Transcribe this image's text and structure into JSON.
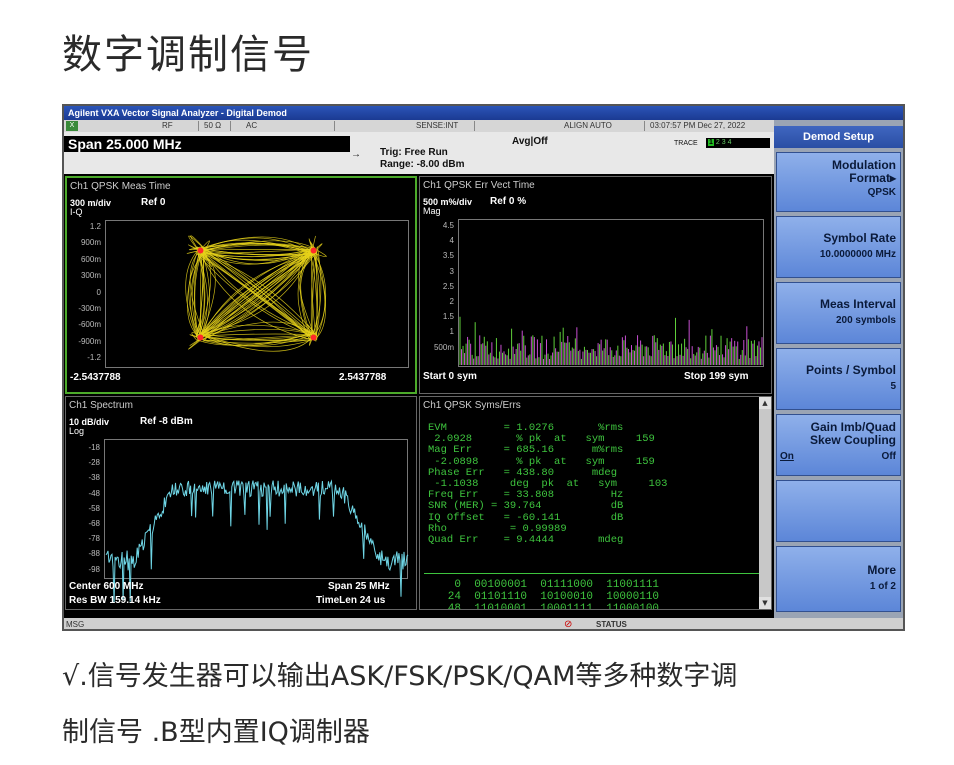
{
  "page": {
    "title": "数字调制信号",
    "caption_line1": "√.信号发生器可以输出ASK/FSK/PSK/QAM等多种数字调",
    "caption_line2": "制信号  .B型内置IQ调制器"
  },
  "window": {
    "title": "Agilent VXA Vector Signal Analyzer - Digital Demod"
  },
  "status_row": {
    "logo": "X",
    "rf": "RF",
    "impedance": "50 Ω",
    "coupling": "AC",
    "sense": "SENSE:INT",
    "align": "ALIGN AUTO",
    "timestamp": "03:07:57 PM Dec 27, 2022"
  },
  "info": {
    "span": "Span 25.000 MHz",
    "avg": "Avg|Off",
    "trig": "Trig: Free Run",
    "range": "Range: -8.00 dBm",
    "trace_label": "TRACE",
    "trace_values": [
      "1",
      "2",
      "3",
      "4"
    ]
  },
  "panels": {
    "constellation": {
      "title": "Ch1 QPSK Meas Time",
      "scale": "300 m/div",
      "ref": "Ref 0",
      "unit": "I-Q",
      "yticks": [
        "1.2",
        "900m",
        "600m",
        "300m",
        "0",
        "-300m",
        "-600m",
        "-900m",
        "-1.2"
      ],
      "left_foot": "-2.5437788",
      "right_foot": "2.5437788",
      "points": [
        [
          -0.75,
          0.75
        ],
        [
          0.75,
          0.75
        ],
        [
          -0.75,
          -0.75
        ],
        [
          0.75,
          -0.75
        ]
      ]
    },
    "evm": {
      "title": "Ch1 QPSK Err Vect Time",
      "scale": "500 m%/div",
      "ref": "Ref 0 %",
      "unit": "Mag",
      "yticks": [
        "4.5",
        "4",
        "3.5",
        "3",
        "2.5",
        "2",
        "1.5",
        "1",
        "500m"
      ],
      "left_foot": "Start 0  sym",
      "right_foot": "Stop 199  sym"
    },
    "spectrum": {
      "title": "Ch1 Spectrum",
      "scale": "10 dB/div",
      "ref": "Ref -8 dBm",
      "unit": "Log",
      "yticks": [
        "-18",
        "-28",
        "-38",
        "-48",
        "-58",
        "-68",
        "-78",
        "-88",
        "-98"
      ],
      "foot_left_1": "Center 600 MHz",
      "foot_right_1": "Span 25 MHz",
      "foot_left_2": "Res BW 159.14 kHz",
      "foot_right_2": "TimeLen 24 us"
    },
    "syms": {
      "title": "Ch1 QPSK Syms/Errs",
      "metrics": [
        "EVM         = 1.0276       %rms",
        " 2.0928       % pk  at   sym     159",
        "Mag Err     = 685.16      m%rms",
        " -2.0898      % pk  at   sym     159",
        "Phase Err   = 438.80      mdeg",
        " -1.1038     deg  pk  at   sym     103",
        "Freq Err    = 33.808         Hz",
        "SNR (MER) = 39.764           dB",
        "IQ Offset   = -60.141        dB",
        "Rho          = 0.99989",
        "Quad Err    = 9.4444       mdeg"
      ],
      "bits": [
        "    0  00100001  01111000  11001111",
        "   24  01101110  10100010  10000110",
        "   48  11010001  10001111  11000100"
      ]
    }
  },
  "sidebar": {
    "header": "Demod Setup",
    "keys": [
      {
        "label": "Modulation Format▸",
        "value": "QPSK"
      },
      {
        "label": "Symbol Rate",
        "value": "10.0000000 MHz"
      },
      {
        "label": "Meas Interval",
        "value": "200 symbols"
      },
      {
        "label": "Points / Symbol",
        "value": "5"
      },
      {
        "label": "Gain Imb/Quad Skew Coupling",
        "value_on": "On",
        "value": "Off"
      },
      {
        "label": "",
        "value": ""
      },
      {
        "label": "More",
        "value": "1 of 2"
      }
    ]
  },
  "bottom": {
    "msg": "MSG",
    "status": "STATUS"
  },
  "colors": {
    "trace_yellow": "#e6d21a",
    "trace_cyan": "#6fd6e6",
    "trace_magenta": "#c64fd0",
    "trace_green": "#5fcf3a",
    "text_green": "#3ec43e"
  }
}
